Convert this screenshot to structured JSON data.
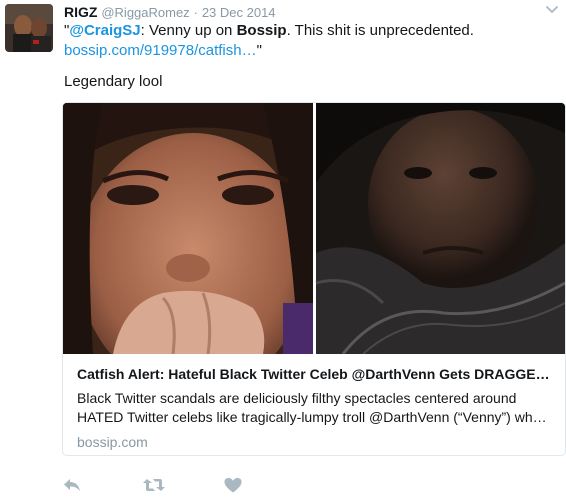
{
  "tweet": {
    "display_name": "RIGZ",
    "handle": "@RiggaRomez",
    "separator": "·",
    "date": "23 Dec 2014",
    "text": {
      "open_quote": "\"",
      "mention": "@CraigSJ",
      "part1": ": Venny up on ",
      "bold_word": "Bossip",
      "part2": ". This shit is unprecedented.",
      "link": "bossip.com/919978/catfish…",
      "close_quote": "\""
    },
    "extra_text": "Legendary lool"
  },
  "card": {
    "title": "Catfish Alert: Hateful Black Twitter Celeb @DarthVenn Gets DRAGGE…",
    "description_line1": "Black Twitter scandals are deliciously filthy spectacles centered around",
    "description_line2": "HATED Twitter celebs like tragically-lumpy troll @DarthVenn (“Venny”) wh…",
    "domain": "bossip.com"
  },
  "icons": {
    "reply": "reply-icon",
    "retweet": "retweet-icon",
    "like": "heart-icon",
    "caret": "chevron-down-icon"
  },
  "colors": {
    "link": "#1b95e0",
    "muted": "#8899a6",
    "icon": "#aab8c2",
    "border": "#e1e8ed"
  }
}
